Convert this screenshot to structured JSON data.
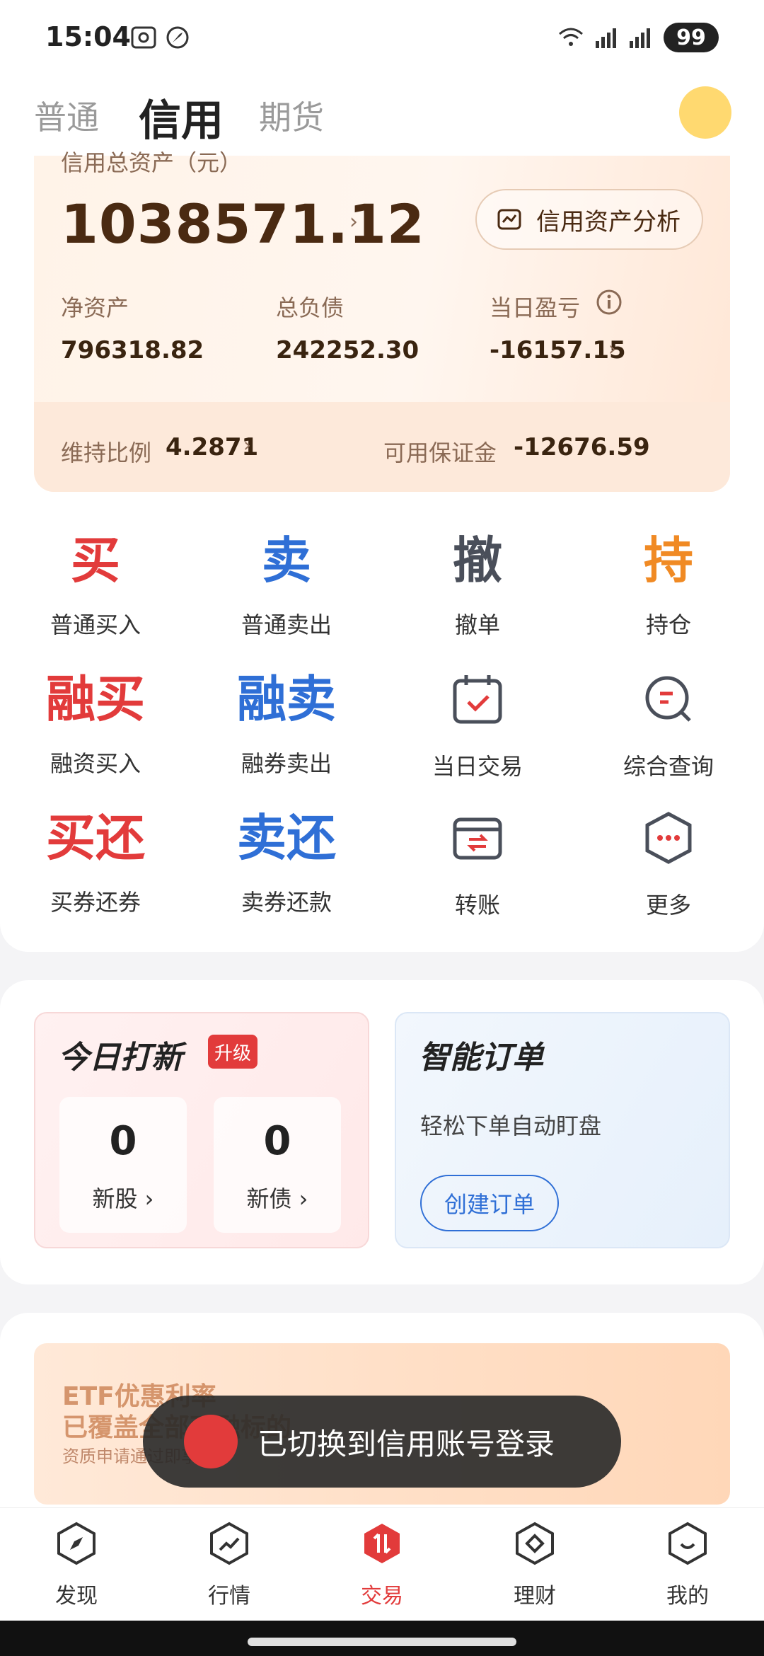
{
  "status_bar": {
    "time": "15:04",
    "battery": "99"
  },
  "tabs": [
    {
      "label": "普通"
    },
    {
      "label": "信用"
    },
    {
      "label": "期货"
    }
  ],
  "asset": {
    "top_label": "信用总资产（元）",
    "total": "1038571.12",
    "analysis_button": "信用资产分析",
    "net_asset_label": "净资产",
    "net_asset_value": "796318.82",
    "total_debt_label": "总负债",
    "total_debt_value": "242252.30",
    "daily_pl_label": "当日盈亏",
    "daily_pl_value": "-16157.15",
    "maintenance_label": "维持比例",
    "maintenance_value": "4.2871",
    "available_margin_label": "可用保证金",
    "available_margin_value": "-12676.59"
  },
  "grid": [
    {
      "glyph": "买",
      "label": "普通买入",
      "color": "#e23b3b"
    },
    {
      "glyph": "卖",
      "label": "普通卖出",
      "color": "#2f6fd6"
    },
    {
      "glyph": "撤",
      "label": "撤单",
      "color": "#4a4f5a"
    },
    {
      "glyph": "持",
      "label": "持仓",
      "color": "#f08a24"
    },
    {
      "glyph": "融买",
      "label": "融资买入",
      "color": "#e23b3b"
    },
    {
      "glyph": "融卖",
      "label": "融券卖出",
      "color": "#2f6fd6"
    },
    {
      "icon": "calendar-icon",
      "label": "当日交易"
    },
    {
      "icon": "search-icon",
      "label": "综合查询"
    },
    {
      "glyph": "买还",
      "label": "买券还券",
      "color": "#e23b3b"
    },
    {
      "glyph": "卖还",
      "label": "卖券还款",
      "color": "#2f6fd6"
    },
    {
      "icon": "transfer-icon",
      "label": "转账"
    },
    {
      "icon": "more-icon",
      "label": "更多"
    }
  ],
  "ipo": {
    "title": "今日打新",
    "badge": "升级",
    "new_stock_count": "0",
    "new_stock_label": "新股 ›",
    "new_bond_count": "0",
    "new_bond_label": "新债 ›"
  },
  "smart_order": {
    "title": "智能订单",
    "subtitle": "轻松下单自动盯盘",
    "button": "创建订单"
  },
  "banner": {
    "title_line1": "ETF优惠利率",
    "title_line2": "已覆盖全部两融标的",
    "subtitle": "资质申请通过即享"
  },
  "toast": {
    "text": "已切换到信用账号登录"
  },
  "bottom_nav": [
    {
      "label": "发现",
      "icon": "compass-icon"
    },
    {
      "label": "行情",
      "icon": "trend-icon"
    },
    {
      "label": "交易",
      "icon": "trade-icon",
      "active": true
    },
    {
      "label": "理财",
      "icon": "diamond-icon"
    },
    {
      "label": "我的",
      "icon": "profile-icon"
    }
  ],
  "colors": {
    "accent_red": "#e23b3b",
    "accent_blue": "#2f6fd6",
    "accent_orange": "#f08a24"
  }
}
